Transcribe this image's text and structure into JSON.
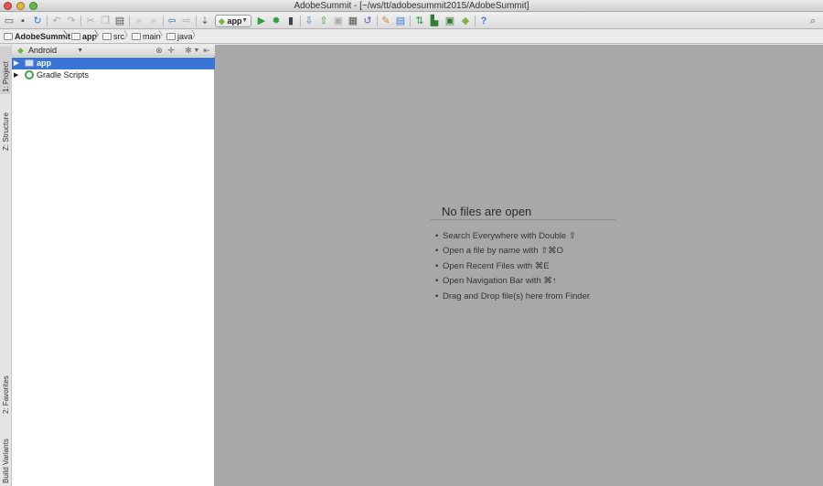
{
  "window": {
    "title": "AdobeSummit - [~/ws/tt/adobesummit2015/AdobeSummit]"
  },
  "toolbar": {
    "run_config_label": "app",
    "icons": [
      "open-icon",
      "save-icon",
      "sync-icon",
      "undo-icon",
      "redo-icon",
      "cut-icon",
      "copy-icon",
      "paste-icon",
      "find-icon",
      "replace-icon",
      "back-icon",
      "forward-icon",
      "make-icon",
      "run-icon",
      "debug-icon",
      "attach-icon",
      "vcs-update-icon",
      "vcs-commit-icon",
      "vcs-compare-icon",
      "vcs-history-icon",
      "vcs-revert-icon",
      "project-structure-icon",
      "sdk-manager-icon",
      "gradle-sync-icon",
      "avd-manager-icon",
      "monitor-icon",
      "android-icon",
      "help-icon",
      "search-icon"
    ]
  },
  "breadcrumb": [
    "AdobeSummit",
    "app",
    "src",
    "main",
    "java"
  ],
  "side_tabs": {
    "top": [
      "1: Project",
      "Z: Structure"
    ],
    "bottom": [
      "2: Favorites",
      "Build Variants"
    ]
  },
  "project_panel": {
    "view_mode": "Android",
    "tree": [
      {
        "label": "app",
        "selected": true
      },
      {
        "label": "Gradle Scripts",
        "selected": false
      }
    ]
  },
  "editor": {
    "empty_title": "No files are open",
    "hints": [
      "Search Everywhere with Double ⇧",
      "Open a file by name with ⇧⌘O",
      "Open Recent Files with ⌘E",
      "Open Navigation Bar with ⌘↑",
      "Drag and Drop file(s) here from Finder"
    ]
  },
  "colors": {
    "selection": "#3875d7",
    "editor_background": "#a8a8a8",
    "android_green": "#7cb342"
  }
}
